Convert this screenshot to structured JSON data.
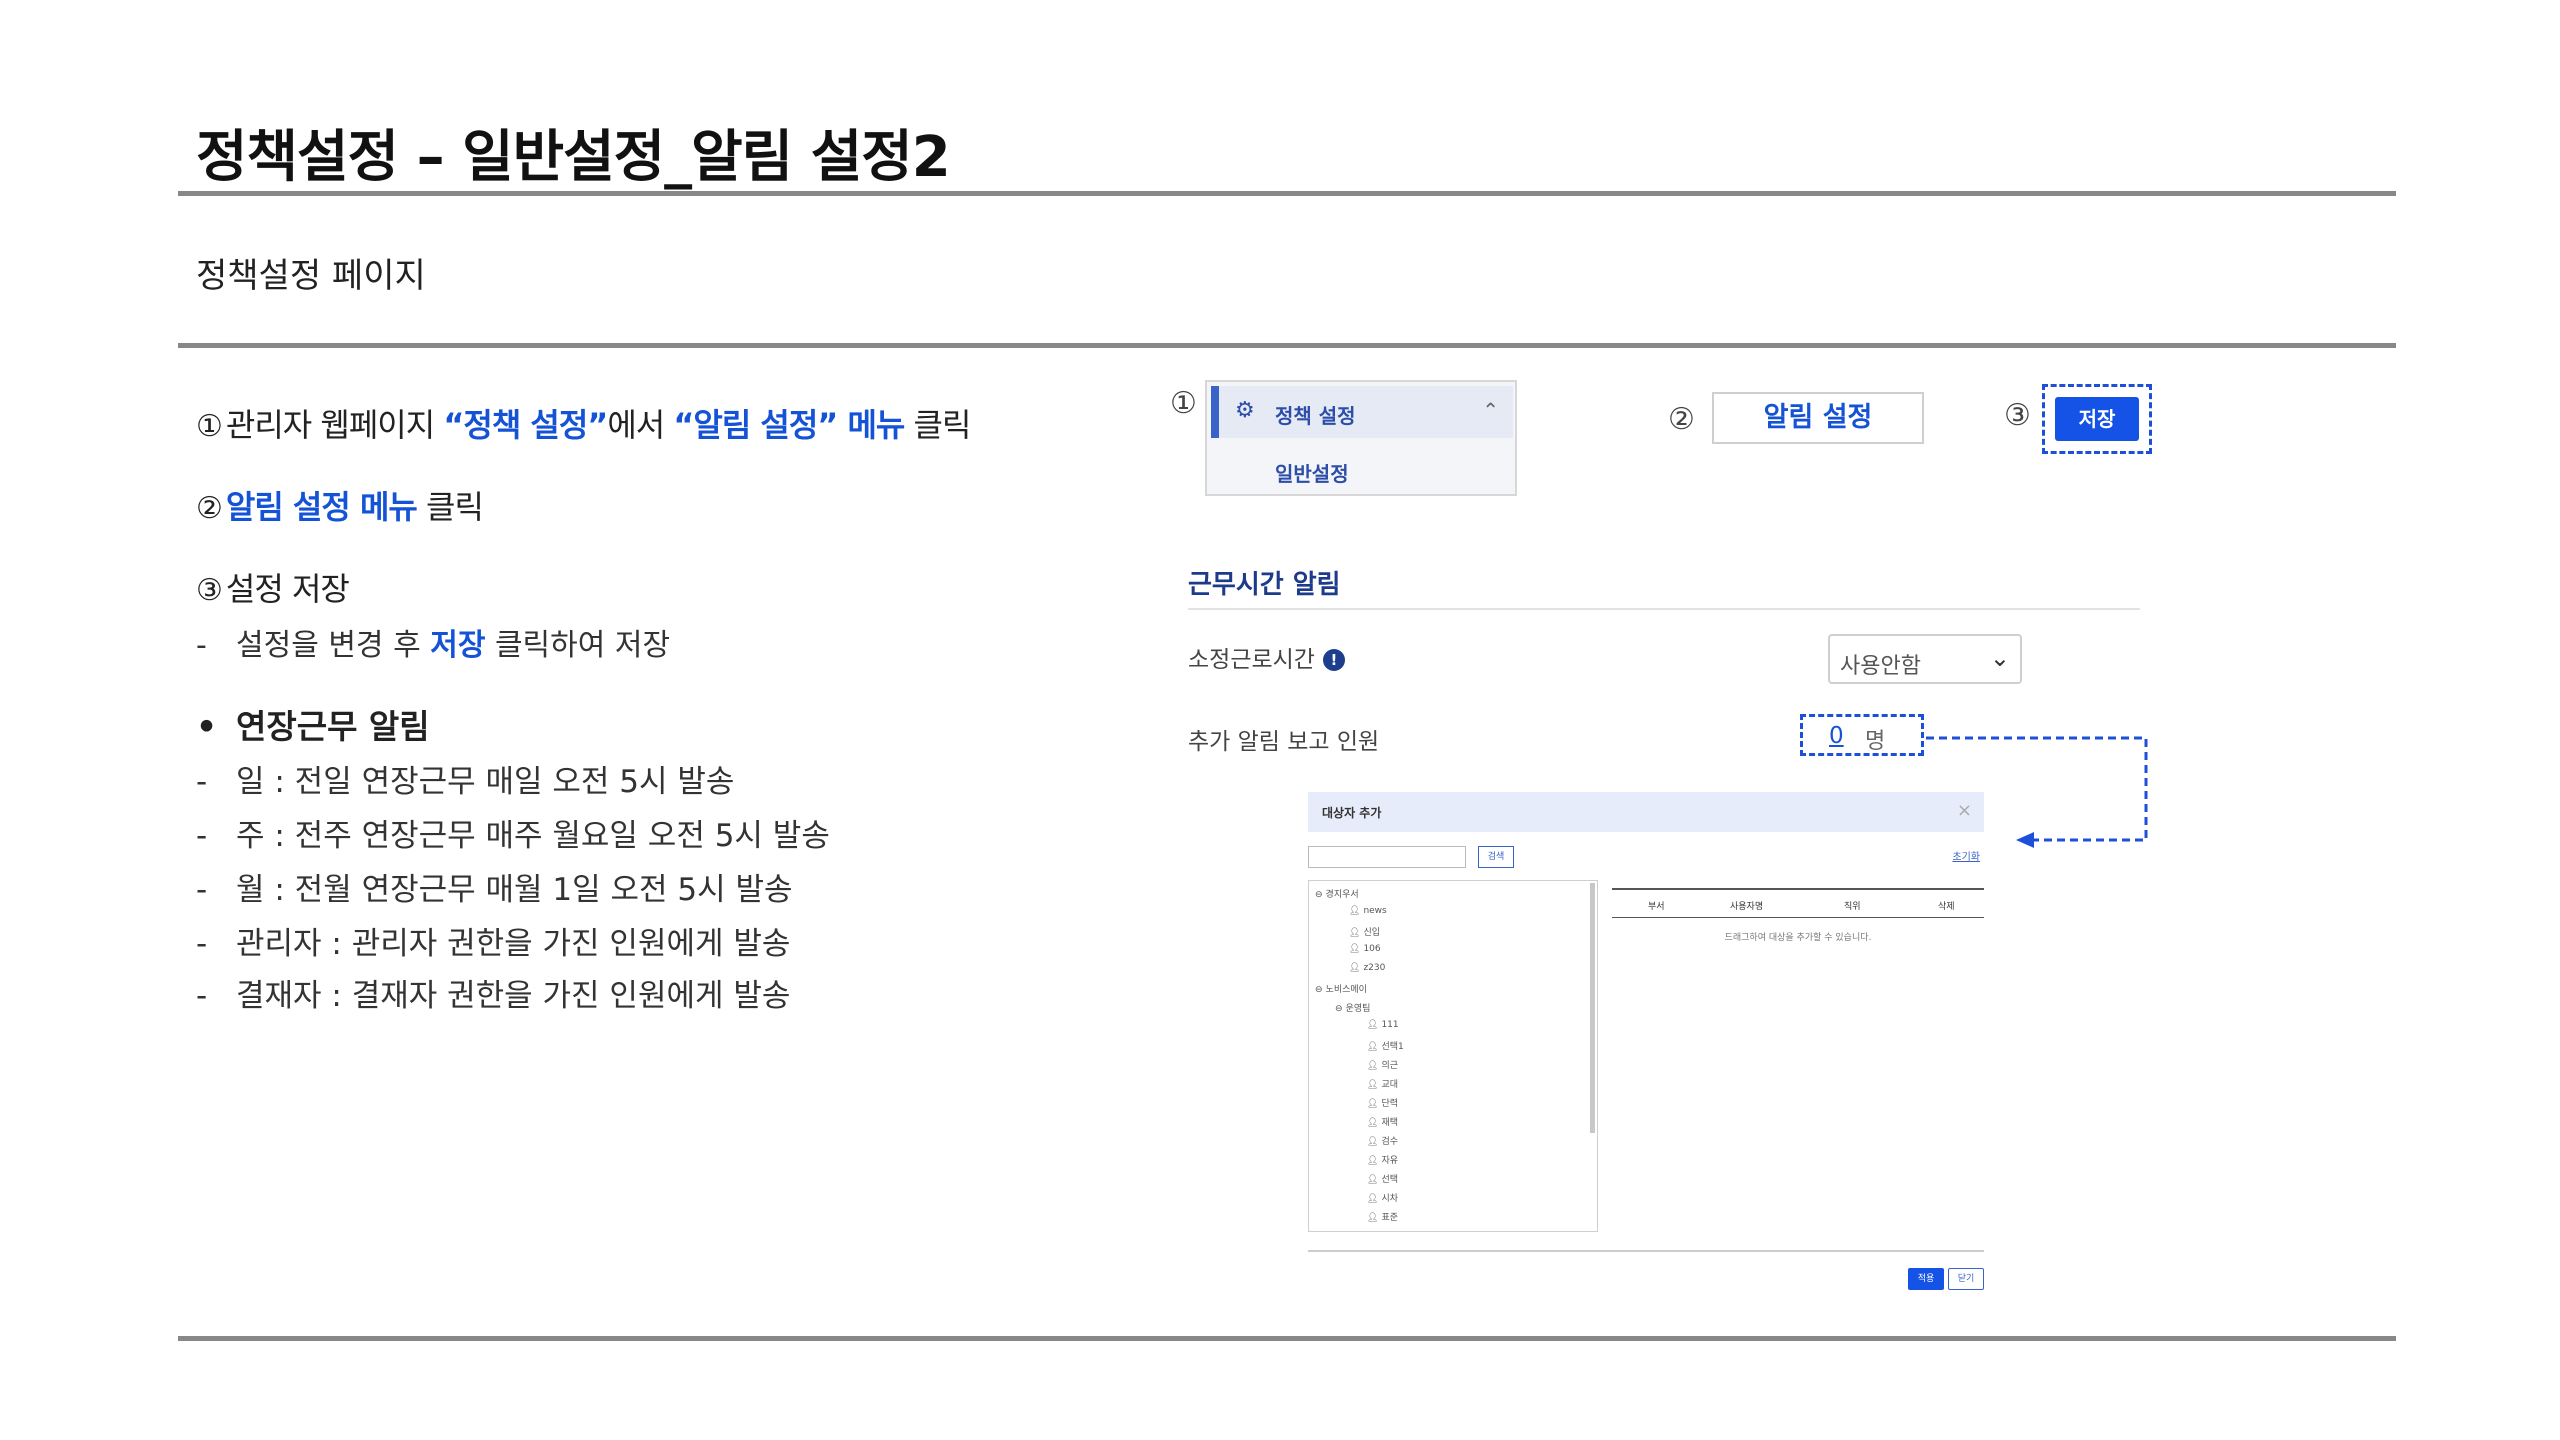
{
  "page": {
    "title": "정책설정 – 일반설정_알림 설정2",
    "subtitle": "정책설정 페이지"
  },
  "steps": {
    "s1_num": "①",
    "s1_a": "관리자 웹페이지 ",
    "s1_b": "“정책 설정”",
    "s1_c": "에서 ",
    "s1_d": "“알림 설정” 메뉴",
    "s1_e": " 클릭",
    "s2_num": "②",
    "s2_a": "알림 설정 메뉴",
    "s2_b": " 클릭",
    "s3_num": "③",
    "s3_a": "설정 저장",
    "s3_sub_a": "설정을 변경 후 ",
    "s3_sub_b": "저장",
    "s3_sub_c": " 클릭하여 저장"
  },
  "bullet": {
    "dot": "•",
    "title": "연장근무 알림",
    "items": [
      "일 : 전일 연장근무 매일 오전 5시 발송",
      "주 : 전주 연장근무 매주 월요일 오전 5시 발송",
      "월 : 전월 연장근무 매월 1일 오전 5시 발송",
      "관리자 : 관리자 권한을 가진 인원에게 발송",
      "결재자 : 결재자 권한을 가진 인원에게 발송"
    ]
  },
  "dash": "-",
  "screenshot": {
    "num1": "①",
    "num2": "②",
    "num3": "③",
    "menu_label": "정책 설정",
    "submenu_label": "일반설정",
    "alarm_tab": "알림 설정",
    "save": "저장",
    "section_heading": "근무시간 알림",
    "field1_label": "소정근로시간",
    "info": "!",
    "select_value": "사용안함",
    "field2_label": "추가 알림 보고 인원",
    "count_value": "0",
    "count_unit": "명"
  },
  "dialog": {
    "title": "대상자 추가",
    "close": "×",
    "search_btn": "검색",
    "reset": "초기화",
    "tree": [
      "경지우서",
      "news",
      "신입",
      "106",
      "z230",
      "노비스메이",
      "운영팀",
      "111",
      "선택1",
      "의근",
      "교대",
      "단력",
      "재택",
      "검수",
      "자유",
      "선택",
      "시차",
      "표준"
    ],
    "columns": [
      "부서",
      "사용자명",
      "직위",
      "삭제"
    ],
    "empty": "드래그하여 대상을 추가할 수 있습니다.",
    "apply": "적용",
    "close_btn": "닫기"
  },
  "colors": {
    "accent": "#1452d6",
    "rule": "#888888",
    "dashed_frame": "#1d4fd8"
  }
}
